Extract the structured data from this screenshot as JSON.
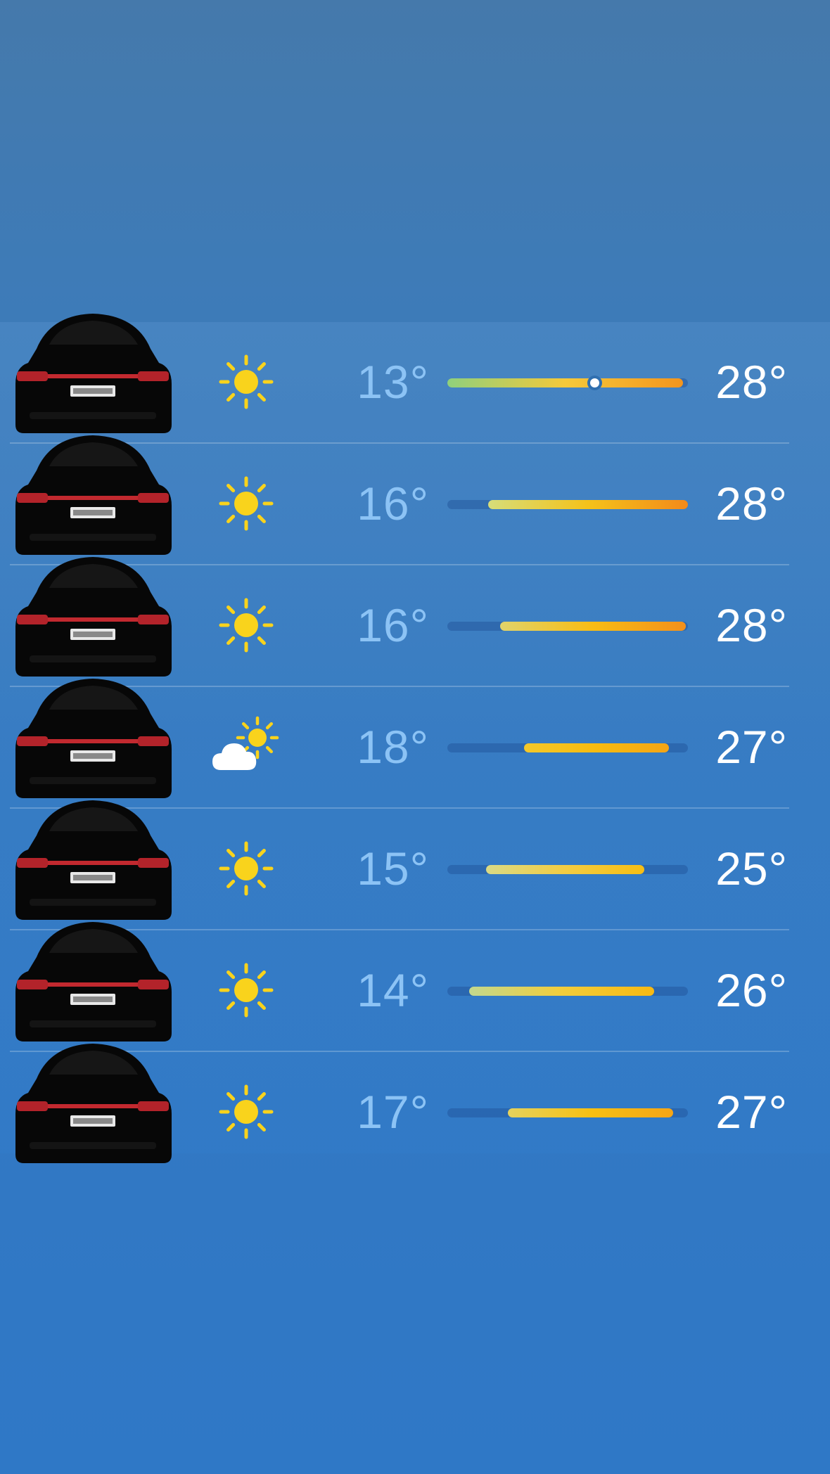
{
  "forecast": {
    "days": [
      {
        "icon": "sun-icon",
        "low": "13°",
        "high": "28°",
        "bar_start": 0.0,
        "bar_end": 0.98,
        "current": 0.61,
        "gradient": [
          "#8fd07c",
          "#f5c93a",
          "#f3951d"
        ]
      },
      {
        "icon": "sun-icon",
        "low": "16°",
        "high": "28°",
        "bar_start": 0.17,
        "bar_end": 1.0,
        "current": null,
        "gradient": [
          "#d6dd7a",
          "#f5c21a",
          "#f38a1a"
        ]
      },
      {
        "icon": "sun-icon",
        "low": "16°",
        "high": "28°",
        "bar_start": 0.22,
        "bar_end": 0.99,
        "current": null,
        "gradient": [
          "#e1d36a",
          "#f7bc14",
          "#f3901b"
        ]
      },
      {
        "icon": "partly-cloudy-icon",
        "low": "18°",
        "high": "27°",
        "bar_start": 0.32,
        "bar_end": 0.92,
        "current": null,
        "gradient": [
          "#f4c82a",
          "#f7bb10",
          "#f4a516"
        ]
      },
      {
        "icon": "sun-icon",
        "low": "15°",
        "high": "25°",
        "bar_start": 0.16,
        "bar_end": 0.82,
        "current": null,
        "gradient": [
          "#d9da86",
          "#f3cc43",
          "#f7be14"
        ]
      },
      {
        "icon": "sun-icon",
        "low": "14°",
        "high": "26°",
        "bar_start": 0.09,
        "bar_end": 0.86,
        "current": null,
        "gradient": [
          "#c2d88e",
          "#f3cd3b",
          "#f7b912"
        ]
      },
      {
        "icon": "sun-icon",
        "low": "17°",
        "high": "27°",
        "bar_start": 0.25,
        "bar_end": 0.94,
        "current": null,
        "gradient": [
          "#e5d25d",
          "#f7c013",
          "#f5a516"
        ]
      }
    ]
  },
  "colors": {
    "low_temp": "#8cc3f5",
    "high_temp": "#ffffff",
    "sun": "#f9d31c",
    "cloud": "#ffffff"
  }
}
